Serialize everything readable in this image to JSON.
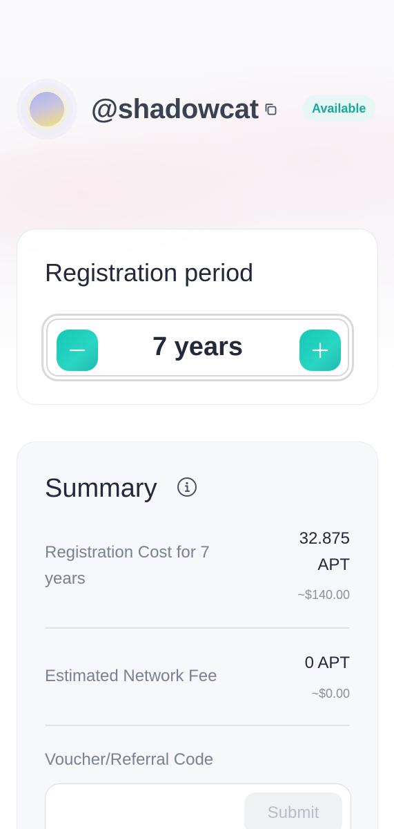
{
  "profile": {
    "handle": "@shadowcat",
    "status_badge": "Available"
  },
  "registration": {
    "title": "Registration period",
    "period_value": "7 years",
    "years": 7
  },
  "summary": {
    "title": "Summary",
    "rows": [
      {
        "label": "Registration Cost for 7 years",
        "value": "32.875 APT",
        "usd": "~$140.00"
      },
      {
        "label": "Estimated Network Fee",
        "value": "0 APT",
        "usd": "~$0.00"
      }
    ],
    "voucher_label": "Voucher/Referral Code",
    "voucher_value": "",
    "submit_label": "Submit"
  },
  "colors": {
    "accent": "#1aa89a",
    "stepper_button": "#20c9b4",
    "badge_bg": "#e8f7f5"
  }
}
